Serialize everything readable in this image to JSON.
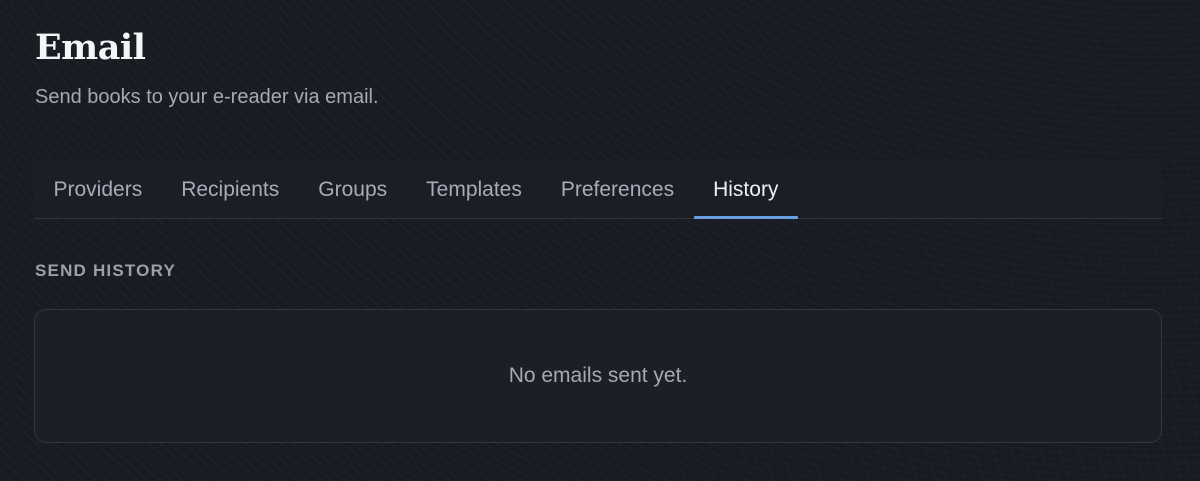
{
  "header": {
    "title": "Email",
    "subtitle": "Send books to your e-reader via email."
  },
  "tabs": [
    {
      "label": "Providers",
      "active": false
    },
    {
      "label": "Recipients",
      "active": false
    },
    {
      "label": "Groups",
      "active": false
    },
    {
      "label": "Templates",
      "active": false
    },
    {
      "label": "Preferences",
      "active": false
    },
    {
      "label": "History",
      "active": true
    }
  ],
  "history": {
    "heading": "SEND HISTORY",
    "empty_message": "No emails sent yet."
  },
  "colors": {
    "background": "#181b22",
    "accent": "#6a9fe2",
    "panel": "#1c1f27"
  }
}
